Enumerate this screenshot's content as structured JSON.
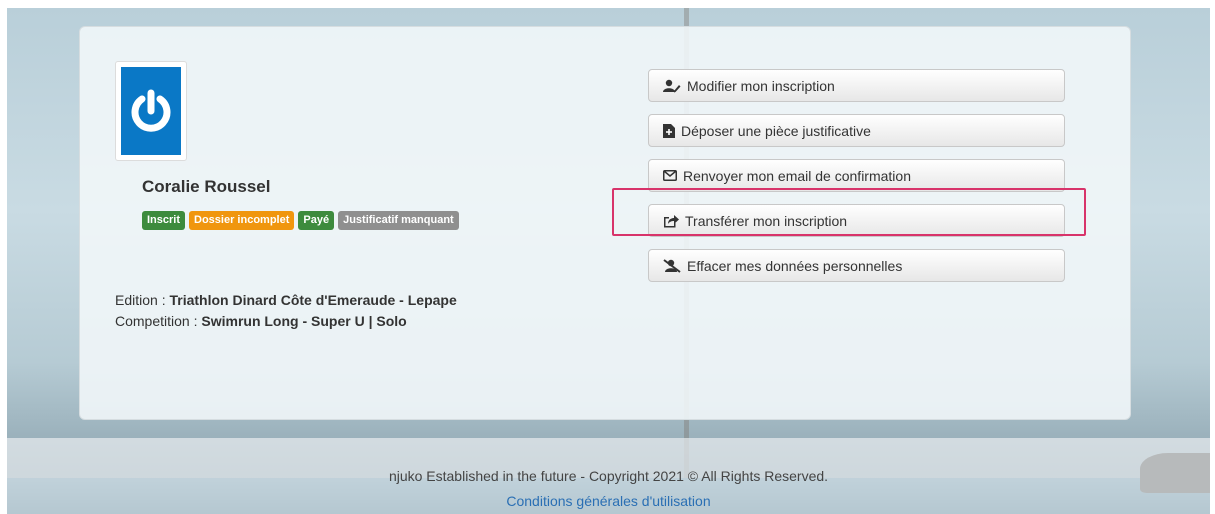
{
  "profile": {
    "name": "Coralie Roussel",
    "avatar_icon": "power-icon",
    "avatar_color": "#0a78c6"
  },
  "badges": [
    {
      "label": "Inscrit",
      "color": "#3d8b3d"
    },
    {
      "label": "Dossier incomplet",
      "color": "#f0960e"
    },
    {
      "label": "Payé",
      "color": "#3d8b3d"
    },
    {
      "label": "Justificatif manquant",
      "color": "#8f8f8f"
    }
  ],
  "info": {
    "edition_label": "Edition : ",
    "edition_value": "Triathlon Dinard Côte d'Emeraude - Lepape",
    "competition_label": "Competition : ",
    "competition_value": "Swimrun Long - Super U | Solo"
  },
  "actions": [
    {
      "label": "Modifier mon inscription",
      "icon": "user-edit-icon"
    },
    {
      "label": "Déposer une pièce justificative",
      "icon": "file-plus-icon"
    },
    {
      "label": "Renvoyer mon email de confirmation",
      "icon": "envelope-icon"
    },
    {
      "label": "Transférer mon inscription",
      "icon": "share-icon"
    },
    {
      "label": "Effacer mes données personnelles",
      "icon": "user-slash-icon"
    }
  ],
  "highlight_color": "#d8336a",
  "footer": {
    "copyright": "njuko Established in the future - Copyright 2021 © All Rights Reserved.",
    "terms_link": "Conditions générales d'utilisation"
  }
}
